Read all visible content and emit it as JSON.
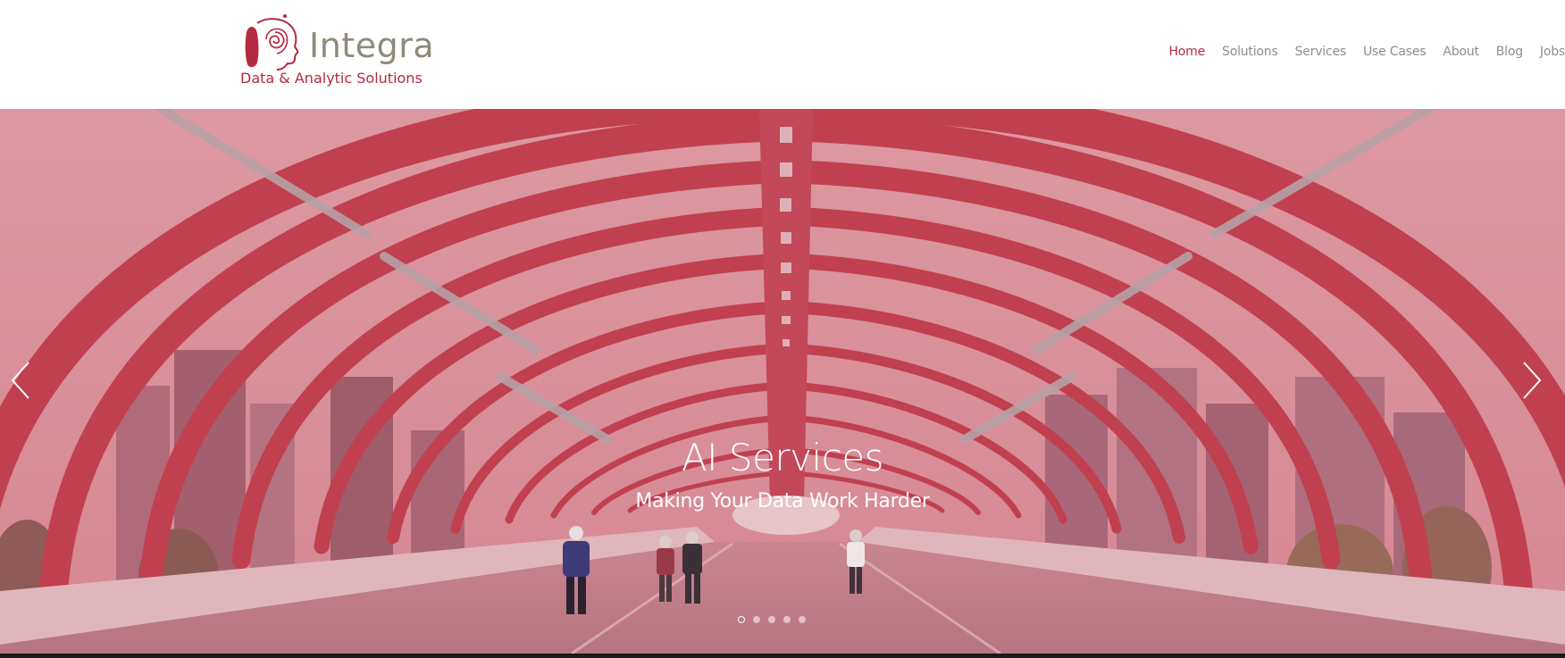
{
  "brand": {
    "name": "Integra",
    "tagline": "Data & Analytic Solutions"
  },
  "nav": {
    "items": [
      {
        "label": "Home",
        "active": true
      },
      {
        "label": "Solutions",
        "active": false
      },
      {
        "label": "Services",
        "active": false
      },
      {
        "label": "Use Cases",
        "active": false
      },
      {
        "label": "About",
        "active": false
      },
      {
        "label": "Blog",
        "active": false
      },
      {
        "label": "Jobs",
        "active": false
      }
    ]
  },
  "hero": {
    "title": "AI Services",
    "subtitle": "Making Your Data Work Harder",
    "slide_count": 5,
    "active_slide": 1,
    "prev_icon": "chevron-left-icon",
    "next_icon": "chevron-right-icon"
  },
  "colors": {
    "accent": "#b42a41",
    "logo_gray": "#8e8a79",
    "nav_text": "#8e8e8e",
    "hero_overlay": "#d98c98"
  }
}
